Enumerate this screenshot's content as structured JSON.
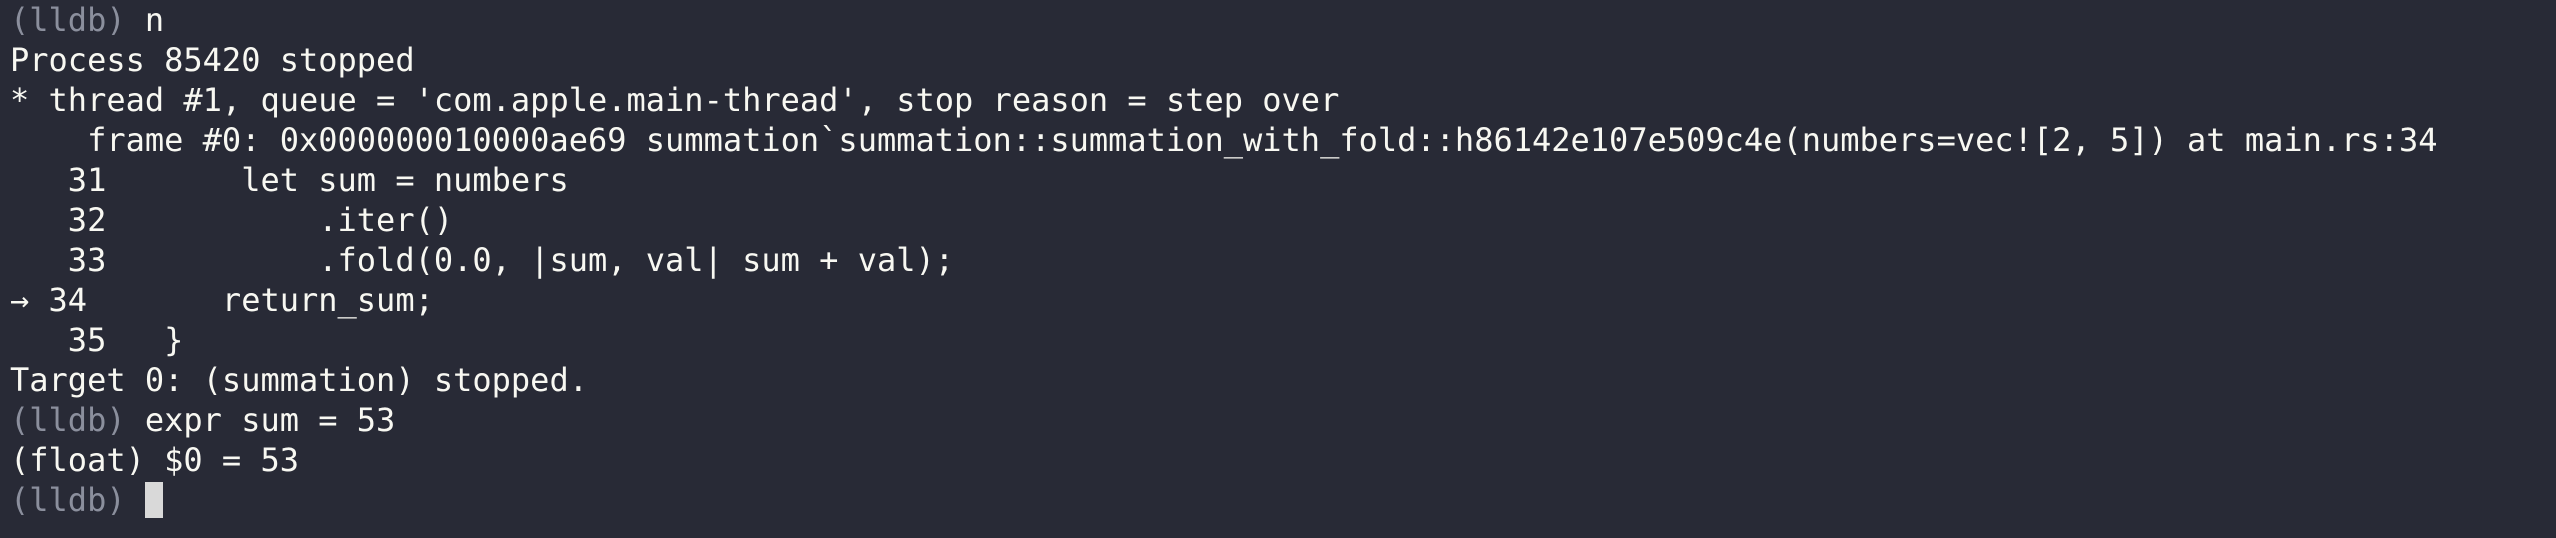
{
  "terminal": {
    "lines": [
      {
        "prompt": "(lldb)",
        "text": " n"
      },
      {
        "text": "Process 85420 stopped"
      },
      {
        "text": "* thread #1, queue = 'com.apple.main-thread', stop reason = step over"
      },
      {
        "text": "    frame #0: 0x000000010000ae69 summation`summation::summation_with_fold::h86142e107e509c4e(numbers=vec![2, 5]) at main.rs:34"
      },
      {
        "text": "   31       let sum = numbers"
      },
      {
        "text": "   32           .iter()"
      },
      {
        "text": "   33           .fold(0.0, |sum, val| sum + val);"
      },
      {
        "text": "→ 34       return_sum;"
      },
      {
        "text": "   35   }"
      },
      {
        "text": "Target 0: (summation) stopped."
      },
      {
        "prompt": "(lldb)",
        "text": " expr sum = 53"
      },
      {
        "text": "(float) $0 = 53"
      },
      {
        "prompt": "(lldb)",
        "text": " ",
        "cursor": true
      }
    ],
    "colors": {
      "background": "#282a36",
      "foreground": "#f8f8f2",
      "prompt": "#8b8f9d",
      "cursor": "#d9d9d9"
    }
  }
}
